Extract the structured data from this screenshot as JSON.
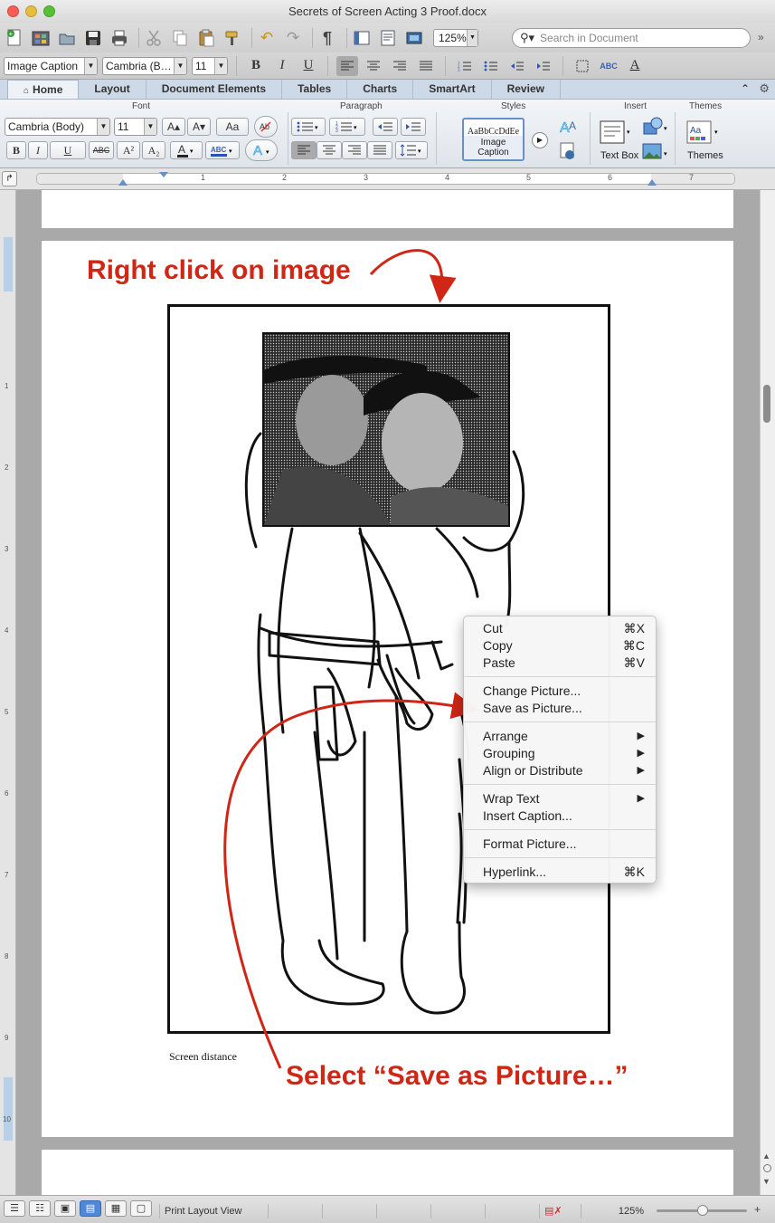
{
  "window": {
    "title": "Secrets of Screen Acting 3 Proof.docx"
  },
  "colors": {
    "close": "#fc5b57",
    "minimize": "#e5bf3c",
    "zoom": "#57c038",
    "annotation": "#d02616",
    "accent": "#4f87d9"
  },
  "toolbar": {
    "zoom_value": "125%",
    "search_placeholder": "Search in Document",
    "icons": [
      "new-doc-icon",
      "templates-icon",
      "open-icon",
      "save-icon",
      "print-icon",
      "cut-icon",
      "copy-icon",
      "paste-icon",
      "format-painter-icon",
      "undo-icon",
      "redo-icon",
      "pilcrow-icon",
      "sidebar-icon",
      "view-icon",
      "media-icon"
    ],
    "pilcrow": "¶"
  },
  "format_bar": {
    "style": "Image Caption",
    "font": "Cambria (B…",
    "size": "11",
    "bold": "B",
    "italic": "I",
    "underline": "U"
  },
  "tabs": [
    {
      "label": "Home",
      "active": true
    },
    {
      "label": "Layout"
    },
    {
      "label": "Document Elements"
    },
    {
      "label": "Tables"
    },
    {
      "label": "Charts"
    },
    {
      "label": "SmartArt"
    },
    {
      "label": "Review"
    }
  ],
  "ribbon": {
    "groups": {
      "font": "Font",
      "paragraph": "Paragraph",
      "styles": "Styles",
      "insert": "Insert",
      "themes": "Themes"
    },
    "font_name": "Cambria (Body)",
    "font_size": "11",
    "grow": "A▴",
    "shrink": "A▾",
    "change_case": "Aa",
    "strike": "ABC",
    "superscript": "A²",
    "subscript": "A₂",
    "style_preview": "AaBbCcDdEe",
    "style_name": "Image Caption",
    "textbox_label": "Text Box",
    "themes_label": "Themes"
  },
  "ruler": {
    "numbers": [
      "1",
      "2",
      "3",
      "4",
      "5",
      "6",
      "7"
    ]
  },
  "vruler": {
    "numbers": [
      "1",
      "2",
      "3",
      "4",
      "5",
      "6",
      "7",
      "8",
      "9",
      "10"
    ]
  },
  "annotations": {
    "top": "Right click on image",
    "bottom": "Select “Save as Picture…”"
  },
  "document": {
    "caption": "Screen distance"
  },
  "context_menu": {
    "items": [
      {
        "label": "Cut",
        "shortcut": "⌘X"
      },
      {
        "label": "Copy",
        "shortcut": "⌘C"
      },
      {
        "label": "Paste",
        "shortcut": "⌘V"
      },
      {
        "label": "Change Picture..."
      },
      {
        "label": "Save as Picture..."
      },
      {
        "label": "Arrange",
        "submenu": "▶"
      },
      {
        "label": "Grouping",
        "submenu": "▶"
      },
      {
        "label": "Align or Distribute",
        "submenu": "▶"
      },
      {
        "label": "Wrap Text",
        "submenu": "▶"
      },
      {
        "label": "Insert Caption..."
      },
      {
        "label": "Format Picture..."
      },
      {
        "label": "Hyperlink...",
        "shortcut": "⌘K"
      }
    ]
  },
  "status": {
    "view_name": "Print Layout View",
    "zoom": "125%"
  }
}
